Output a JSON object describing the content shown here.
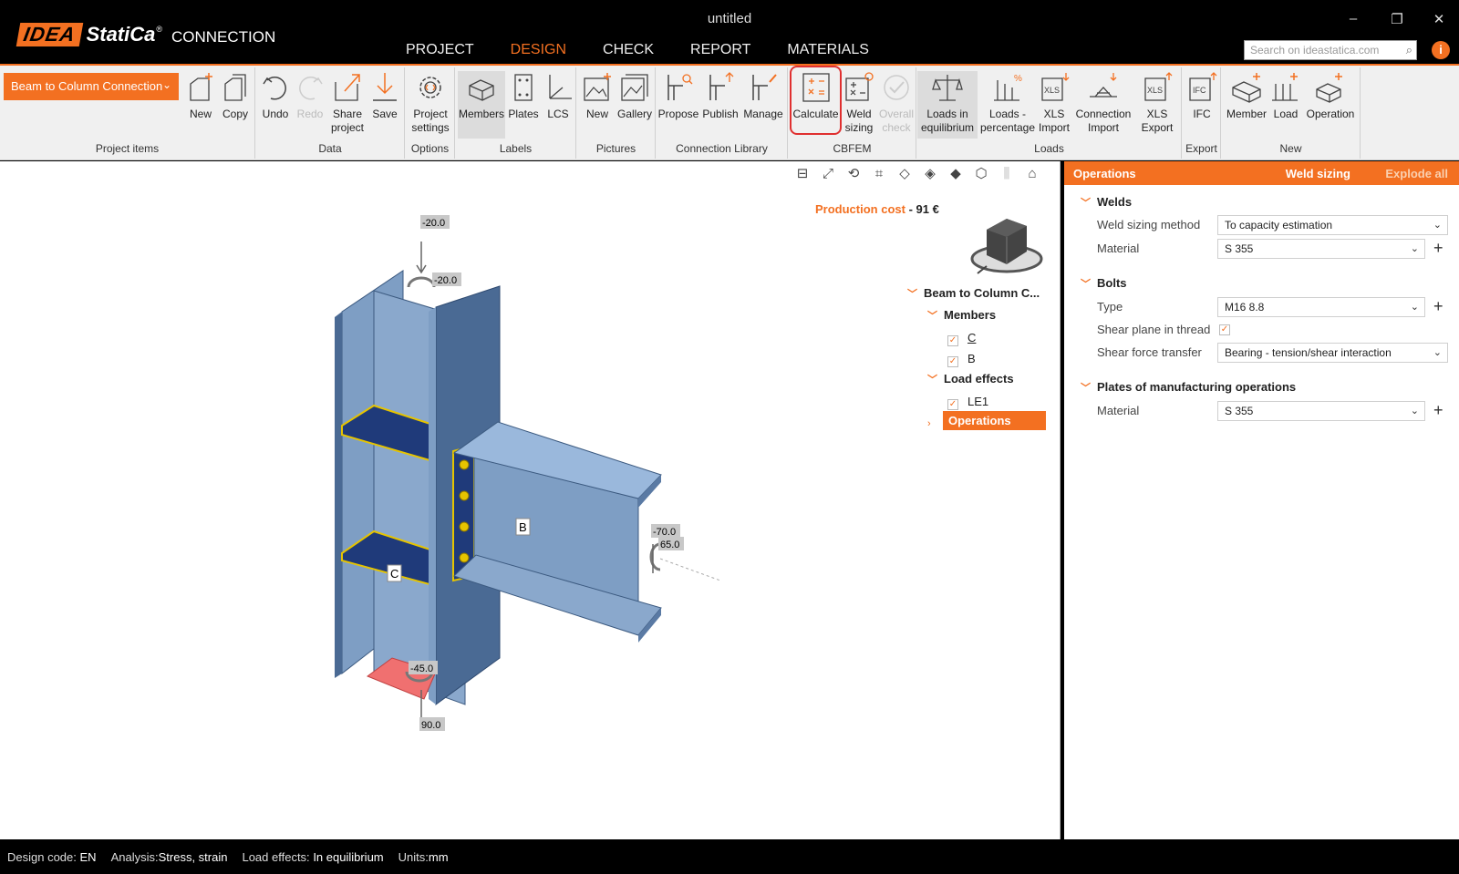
{
  "app": {
    "logo_idea": "IDEA",
    "logo_statica": "StatiCa",
    "logo_reg": "®",
    "product": "CONNECTION",
    "window_title": "untitled",
    "window_buttons": {
      "minimize": "–",
      "restore": "❐",
      "close": "✕"
    }
  },
  "main_tabs": [
    {
      "label": "PROJECT"
    },
    {
      "label": "DESIGN",
      "active": true
    },
    {
      "label": "CHECK"
    },
    {
      "label": "REPORT"
    },
    {
      "label": "MATERIALS"
    }
  ],
  "search": {
    "placeholder": "Search on ideastatica.com"
  },
  "info_label": "i",
  "ribbon": {
    "project_combo": "Beam to Column Connection",
    "groups": {
      "project_items": "Project items",
      "data": "Data",
      "options": "Options",
      "labels": "Labels",
      "pictures": "Pictures",
      "connection_library": "Connection Library",
      "cbfem": "CBFEM",
      "loads": "Loads",
      "export": "Export",
      "new": "New"
    },
    "buttons": {
      "new": "New",
      "copy": "Copy",
      "undo": "Undo",
      "redo": "Redo",
      "share_1": "Share",
      "share_2": "project",
      "save": "Save",
      "project_settings_1": "Project",
      "project_settings_2": "settings",
      "members": "Members",
      "plates": "Plates",
      "lcs": "LCS",
      "pic_new": "New",
      "gallery": "Gallery",
      "propose": "Propose",
      "publish": "Publish",
      "manage": "Manage",
      "calculate": "Calculate",
      "weld_1": "Weld",
      "weld_2": "sizing",
      "overall_1": "Overall",
      "overall_2": "check",
      "loads_eq_1": "Loads in",
      "loads_eq_2": "equilibrium",
      "loads_pct_1": "Loads -",
      "loads_pct_2": "percentage",
      "xls_import_1": "XLS",
      "xls_import_2": "Import",
      "conn_import_1": "Connection",
      "conn_import_2": "Import",
      "xls_export_1": "XLS",
      "xls_export_2": "Export",
      "ifc": "IFC",
      "member": "Member",
      "load": "Load",
      "operation": "Operation"
    }
  },
  "viewport": {
    "production_cost_label": "Production cost",
    "production_cost_sep": " - ",
    "production_cost_value": "91 €",
    "labels": {
      "top_force": "-20.0",
      "top_moment": "-20.0",
      "right_force": "-70.0",
      "right_moment": "65.0",
      "bottom_moment": "-45.0",
      "bottom_force": "90.0",
      "member_b": "B",
      "member_c": "C"
    },
    "tree": {
      "root": "Beam to Column C...",
      "members": "Members",
      "member_c": "C",
      "member_b": "B",
      "load_effects": "Load effects",
      "le1": "LE1",
      "operations": "Operations"
    }
  },
  "panel": {
    "title": "Operations",
    "weld_sizing": "Weld sizing",
    "explode_all": "Explode all",
    "welds": {
      "section": "Welds",
      "method_label": "Weld sizing method",
      "method_value": "To capacity estimation",
      "material_label": "Material",
      "material_value": "S 355"
    },
    "bolts": {
      "section": "Bolts",
      "type_label": "Type",
      "type_value": "M16 8.8",
      "shear_plane_label": "Shear plane in thread",
      "shear_plane_checked": true,
      "shear_transfer_label": "Shear force transfer",
      "shear_transfer_value": "Bearing - tension/shear interaction"
    },
    "plates": {
      "section": "Plates of manufacturing operations",
      "material_label": "Material",
      "material_value": "S 355"
    }
  },
  "status": {
    "design_code_label": "Design code:",
    "design_code_value": "EN",
    "analysis_label": "Analysis:",
    "analysis_value": "Stress, strain",
    "load_effects_label": "Load effects:",
    "load_effects_value": "In equilibrium",
    "units_label": "Units:",
    "units_value": "mm"
  },
  "colors": {
    "accent": "#f37021",
    "steel": "#7e9ec4",
    "steel_dark": "#4a6a94",
    "stiffener": "#1f3a7a",
    "weld": "#e6c400",
    "base_plate": "#f07070",
    "highlight": "#e03030"
  }
}
